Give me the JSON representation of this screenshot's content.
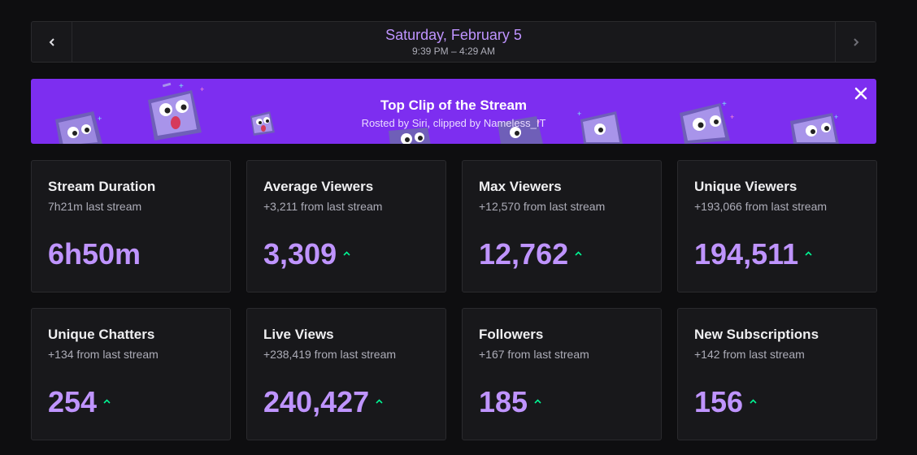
{
  "date_nav": {
    "title": "Saturday, February 5",
    "time_range": "9:39 PM – 4:29 AM",
    "prev_icon": "chevron-left-icon",
    "next_icon": "chevron-right-icon"
  },
  "banner": {
    "title": "Top Clip of the Stream",
    "subtitle": "Rosted by Siri, clipped by Nameless_IT",
    "close_icon": "close-icon",
    "background_color": "#7d2ef0"
  },
  "colors": {
    "accent": "#bf94ff",
    "trend_up": "#00f593",
    "card_bg": "#18181b",
    "page_bg": "#0e0e10"
  },
  "stats": [
    {
      "title": "Stream Duration",
      "sub": "7h21m last stream",
      "value": "6h50m",
      "trend": ""
    },
    {
      "title": "Average Viewers",
      "sub": "+3,211 from last stream",
      "value": "3,309",
      "trend": "up"
    },
    {
      "title": "Max Viewers",
      "sub": "+12,570 from last stream",
      "value": "12,762",
      "trend": "up"
    },
    {
      "title": "Unique Viewers",
      "sub": "+193,066 from last stream",
      "value": "194,511",
      "trend": "up"
    },
    {
      "title": "Unique Chatters",
      "sub": "+134 from last stream",
      "value": "254",
      "trend": "up"
    },
    {
      "title": "Live Views",
      "sub": "+238,419 from last stream",
      "value": "240,427",
      "trend": "up"
    },
    {
      "title": "Followers",
      "sub": "+167 from last stream",
      "value": "185",
      "trend": "up"
    },
    {
      "title": "New Subscriptions",
      "sub": "+142 from last stream",
      "value": "156",
      "trend": "up"
    }
  ]
}
